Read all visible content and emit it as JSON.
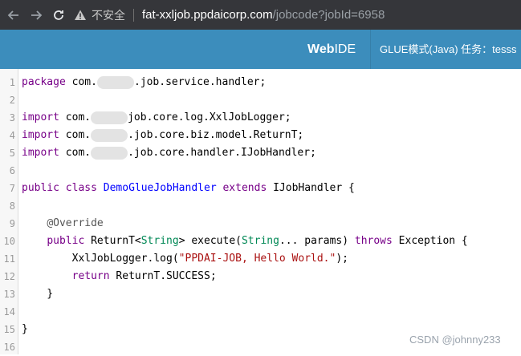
{
  "browser": {
    "security_label": "不安全",
    "url_host": "fat-xxljob.ppdaicorp.com",
    "url_path": "/jobcode?jobId=6958"
  },
  "app": {
    "logo_bold": "Web",
    "logo_normal": "IDE",
    "header_info": "GLUE模式(Java) 任务：tesss"
  },
  "editor": {
    "lines": [
      {
        "n": "1",
        "segments": [
          {
            "t": "package",
            "c": "kw"
          },
          {
            "t": " com.",
            "c": ""
          },
          {
            "blur": true
          },
          {
            "t": ".job.service.handler;",
            "c": ""
          }
        ]
      },
      {
        "n": "2",
        "segments": []
      },
      {
        "n": "3",
        "segments": [
          {
            "t": "import",
            "c": "kw"
          },
          {
            "t": " com.",
            "c": ""
          },
          {
            "blur": true
          },
          {
            "t": "job.core.log.XxlJobLogger;",
            "c": ""
          }
        ]
      },
      {
        "n": "4",
        "segments": [
          {
            "t": "import",
            "c": "kw"
          },
          {
            "t": " com.",
            "c": ""
          },
          {
            "blur": true
          },
          {
            "t": ".job.core.biz.model.ReturnT;",
            "c": ""
          }
        ]
      },
      {
        "n": "5",
        "segments": [
          {
            "t": "import",
            "c": "kw"
          },
          {
            "t": " com.",
            "c": ""
          },
          {
            "blur": true
          },
          {
            "t": ".job.core.handler.IJobHandler;",
            "c": ""
          }
        ]
      },
      {
        "n": "6",
        "segments": []
      },
      {
        "n": "7",
        "segments": [
          {
            "t": "public",
            "c": "kw"
          },
          {
            "t": " ",
            "c": ""
          },
          {
            "t": "class",
            "c": "kw"
          },
          {
            "t": " ",
            "c": ""
          },
          {
            "t": "DemoGlueJobHandler",
            "c": "def"
          },
          {
            "t": " ",
            "c": ""
          },
          {
            "t": "extends",
            "c": "kw"
          },
          {
            "t": " IJobHandler {",
            "c": ""
          }
        ]
      },
      {
        "n": "8",
        "segments": []
      },
      {
        "n": "9",
        "segments": [
          {
            "t": "    ",
            "c": ""
          },
          {
            "t": "@Override",
            "c": "meta"
          }
        ]
      },
      {
        "n": "10",
        "segments": [
          {
            "t": "    ",
            "c": ""
          },
          {
            "t": "public",
            "c": "kw"
          },
          {
            "t": " ReturnT<",
            "c": ""
          },
          {
            "t": "String",
            "c": "var3"
          },
          {
            "t": "> execute(",
            "c": ""
          },
          {
            "t": "String",
            "c": "var3"
          },
          {
            "t": "... params) ",
            "c": ""
          },
          {
            "t": "throws",
            "c": "kw"
          },
          {
            "t": " Exception {",
            "c": ""
          }
        ]
      },
      {
        "n": "11",
        "segments": [
          {
            "t": "        XxlJobLogger.log(",
            "c": ""
          },
          {
            "t": "\"PPDAI-JOB, Hello World.\"",
            "c": "str"
          },
          {
            "t": ");",
            "c": ""
          }
        ]
      },
      {
        "n": "12",
        "segments": [
          {
            "t": "        ",
            "c": ""
          },
          {
            "t": "return",
            "c": "kw"
          },
          {
            "t": " ReturnT.SUCCESS;",
            "c": ""
          }
        ]
      },
      {
        "n": "13",
        "segments": [
          {
            "t": "    }",
            "c": ""
          }
        ]
      },
      {
        "n": "14",
        "segments": []
      },
      {
        "n": "15",
        "segments": [
          {
            "t": "}",
            "c": ""
          }
        ]
      },
      {
        "n": "16",
        "segments": []
      }
    ]
  },
  "watermark": "CSDN @johnny233"
}
